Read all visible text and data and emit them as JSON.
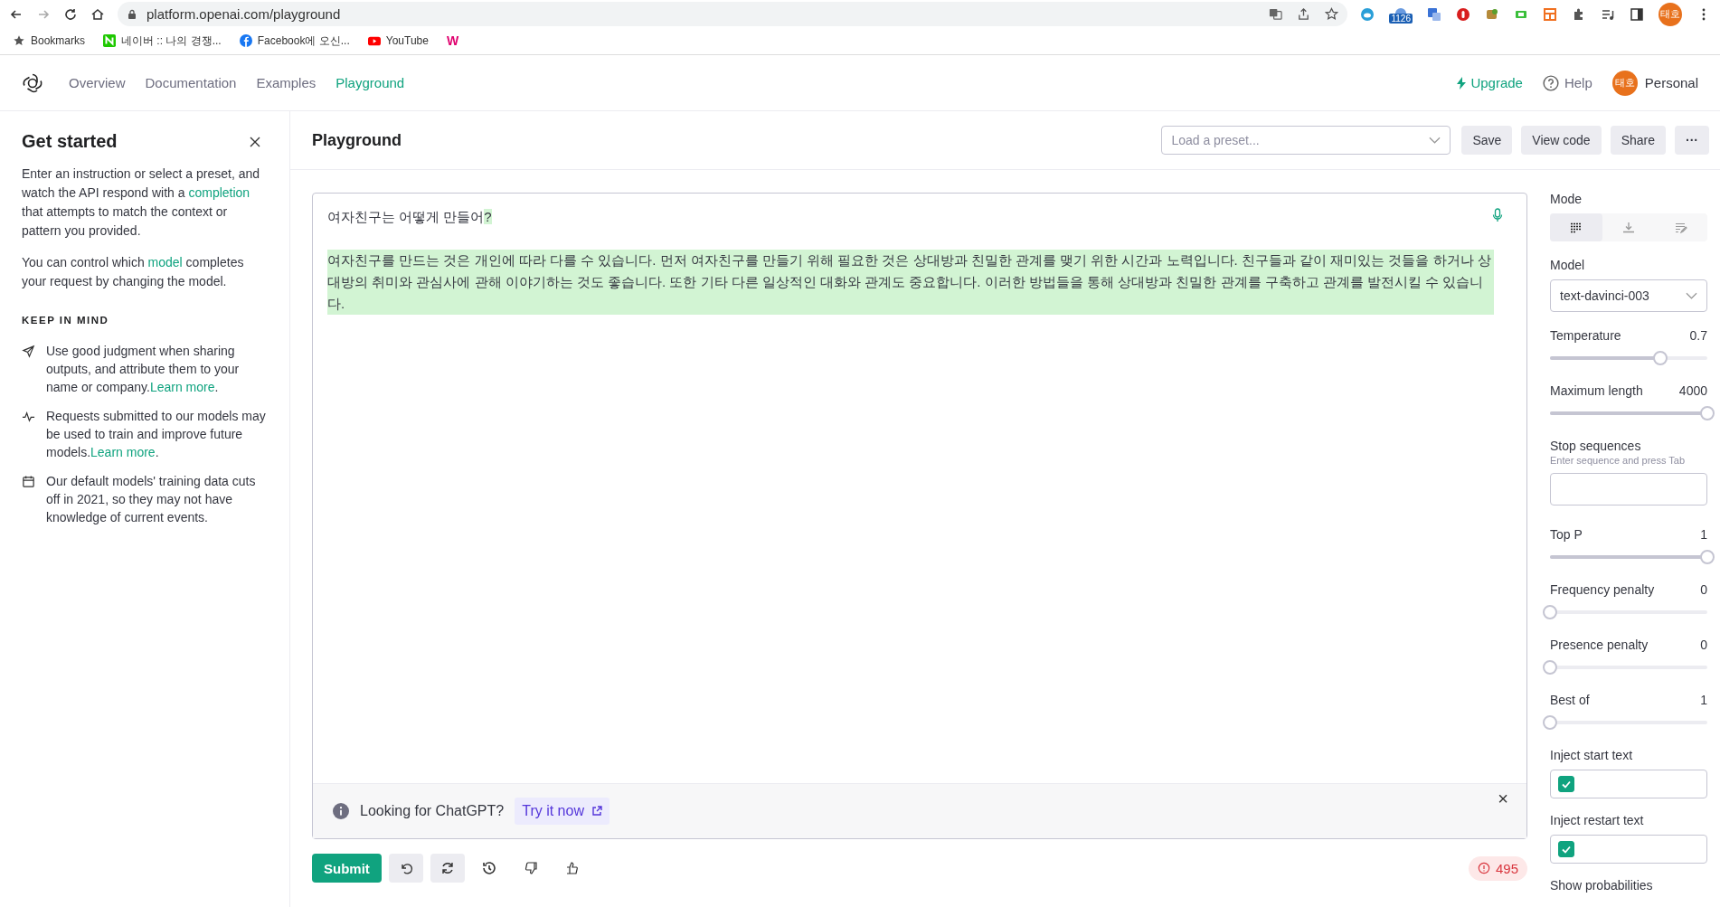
{
  "browser": {
    "url": "platform.openai.com/playground",
    "extension_badge": "1126",
    "profile": "태호",
    "bookmarks": [
      {
        "label": "Bookmarks",
        "kind": "star"
      },
      {
        "label": "네이버 :: 나의 경쟁...",
        "kind": "naver"
      },
      {
        "label": "Facebook에 오신...",
        "kind": "facebook"
      },
      {
        "label": "YouTube",
        "kind": "youtube"
      },
      {
        "label": "W",
        "kind": "letter"
      }
    ]
  },
  "nav": {
    "items": [
      {
        "label": "Overview",
        "selected": false
      },
      {
        "label": "Documentation",
        "selected": false
      },
      {
        "label": "Examples",
        "selected": false
      },
      {
        "label": "Playground",
        "selected": true
      }
    ],
    "upgrade": "Upgrade",
    "help": "Help",
    "avatar": "태호",
    "account": "Personal"
  },
  "sidebar": {
    "title": "Get started",
    "paragraphs": [
      {
        "before": "Enter an instruction or select a preset, and watch the API respond with a ",
        "link": "completion",
        "after": " that attempts to match the context or pattern you provided."
      },
      {
        "before": "You can control which ",
        "link": "model",
        "after": " completes your request by changing the model."
      }
    ],
    "section": "KEEP IN MIND",
    "notes": [
      {
        "kind": "send",
        "text": "Use good judgment when sharing outputs, and attribute them to your name or company.",
        "link": "Learn more",
        "after": "."
      },
      {
        "kind": "pulse",
        "text": "Requests submitted to our models may be used to train and improve future models.",
        "link": "Learn more",
        "after": "."
      },
      {
        "kind": "calendar",
        "text": "Our default models' training data cuts off in 2021, so they may not have knowledge of current events."
      }
    ]
  },
  "header": {
    "title": "Playground",
    "preset_placeholder": "Load a preset...",
    "buttons": [
      "Save",
      "View code",
      "Share"
    ],
    "more": "···"
  },
  "editor": {
    "lines": [
      [
        {
          "text": "여자친구는 어떻게 만들어",
          "highlighted": false
        },
        {
          "text": "?",
          "highlighted": true
        }
      ],
      [
        {
          "text": "여자친구를 만드는 것은 개인에 따라 다를 수 있습니다. 먼저 여자친구를 만들기 위해 필요한 것은 상대방과 친밀한 관계를 맺기 위한 시간과 노력입니다. 친구들과 같이 재미있는 것들을 하거나 상대방의 취미와 관심사에 관해 이야기하는 것도 좋습니다. 또한 기타 다른 일상적인 대화와 관계도 중요합니다. 이러한 방법들을 통해 상대방과 친밀한 관계를 구축하고 관계를 발전시킬 수 있습니다.",
          "highlighted": true
        }
      ]
    ],
    "banner": {
      "text": "Looking for ChatGPT?",
      "link": "Try it now",
      "close": "×"
    }
  },
  "actions": {
    "submit": "Submit",
    "token_count": "495"
  },
  "settings": {
    "mode_label": "Mode",
    "modes": [
      {
        "kind": "complete",
        "selected": true
      },
      {
        "kind": "insert",
        "selected": false
      },
      {
        "kind": "edit",
        "selected": false
      }
    ],
    "model_label": "Model",
    "model": "text-davinci-003",
    "controls": [
      {
        "kind": "slider",
        "label": "Temperature",
        "reading": "0.7",
        "level": 0.7
      },
      {
        "kind": "slider",
        "label": "Maximum length",
        "reading": "4000",
        "level": 1
      },
      {
        "kind": "text",
        "label": "Stop sequences",
        "hint": "Enter sequence and press Tab"
      },
      {
        "kind": "slider",
        "label": "Top P",
        "reading": "1",
        "level": 1
      },
      {
        "kind": "slider",
        "label": "Frequency penalty",
        "reading": "0",
        "level": 0
      },
      {
        "kind": "slider",
        "label": "Presence penalty",
        "reading": "0",
        "level": 0
      },
      {
        "kind": "slider",
        "label": "Best of",
        "reading": "1",
        "level": 0
      },
      {
        "kind": "checkbox",
        "label": "Inject start text",
        "checked": true
      },
      {
        "kind": "checkbox",
        "label": "Inject restart text",
        "checked": true
      },
      {
        "kind": "label",
        "label": "Show probabilities"
      }
    ]
  }
}
